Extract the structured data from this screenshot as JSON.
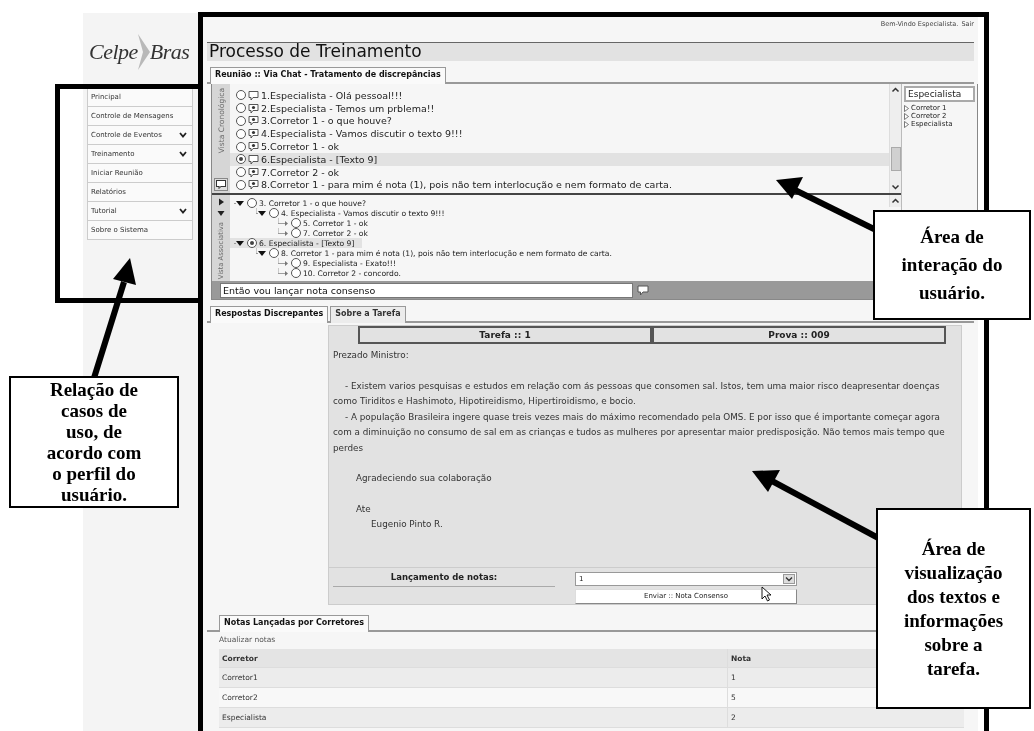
{
  "sidebar": {
    "logo": {
      "left": "Celpe",
      "right": "Bras"
    },
    "items": [
      {
        "label": "Principal",
        "kind": "link"
      },
      {
        "label": "Controle de Mensagens",
        "kind": "link"
      },
      {
        "label": "Controle de Eventos",
        "kind": "menu"
      },
      {
        "label": "Treinamento",
        "kind": "menu"
      },
      {
        "label": "Iniciar Reunião",
        "kind": "link"
      },
      {
        "label": "Relatórios",
        "kind": "link"
      },
      {
        "label": "Tutorial",
        "kind": "menu"
      },
      {
        "label": "Sobre o Sistema",
        "kind": "link"
      }
    ]
  },
  "header": {
    "welcome": "Bem-Vindo Especialista.",
    "logout": "Sair"
  },
  "title": "Processo de Treinamento",
  "chat": {
    "tab": "Reunião :: Via Chat - Tratamento de discrepâncias",
    "chrono_label": "Vista Cronológica",
    "messages": [
      {
        "text": "1.Especialista - Olá pessoal!!!",
        "marked": false,
        "selected": false
      },
      {
        "text": "2.Especialista - Temos um prblema!!",
        "marked": true,
        "selected": false
      },
      {
        "text": "3.Corretor 1 - o que houve?",
        "marked": true,
        "selected": false
      },
      {
        "text": "4.Especialista - Vamos discutir o texto 9!!!",
        "marked": true,
        "selected": false
      },
      {
        "text": "5.Corretor 1 - ok",
        "marked": true,
        "selected": false
      },
      {
        "text": "6.Especialista - [Texto 9]",
        "marked": false,
        "selected": true
      },
      {
        "text": "7.Corretor 2 - ok",
        "marked": true,
        "selected": false
      },
      {
        "text": "8.Corretor 1 - para mim é nota (1), pois não tem interlocução e nem formato de carta.",
        "marked": true,
        "selected": false
      }
    ],
    "assoc_label": "Vista Associativa",
    "tree": [
      {
        "text": "3. Corretor 1 - o que houve?",
        "expanded": true,
        "selected": false,
        "children": [
          {
            "text": "4. Especialista - Vamos discutir o texto 9!!!",
            "expanded": true,
            "selected": false,
            "children": [
              {
                "text": "5. Corretor 1 - ok",
                "expanded": false,
                "selected": false
              },
              {
                "text": "7. Corretor 2 - ok",
                "expanded": false,
                "selected": false
              }
            ]
          }
        ]
      },
      {
        "text": "6. Especialista - [Texto 9]",
        "expanded": true,
        "selected": true,
        "children": [
          {
            "text": "8. Corretor 1 - para mim é nota (1), pois não tem interlocução e nem formato de carta.",
            "expanded": true,
            "selected": false,
            "children": [
              {
                "text": "9. Especialista - Exato!!!",
                "expanded": false,
                "selected": false
              },
              {
                "text": "10. Corretor 2 - concordo.",
                "expanded": false,
                "selected": false
              }
            ]
          }
        ]
      }
    ],
    "input": {
      "value": "Então vou lançar nota consenso"
    },
    "users": {
      "header": "Especialista",
      "items": [
        "Corretor 1",
        "Corretor 2",
        "Especialista"
      ]
    }
  },
  "task": {
    "tabs": [
      {
        "label": "Respostas Discrepantes",
        "selected": true
      },
      {
        "label": "Sobre a Tarefa",
        "selected": false
      }
    ],
    "header": [
      "Tarefa :: 1",
      "Prova :: 009"
    ],
    "letter": [
      {
        "kind": "salutation",
        "text": "Prezado Ministro:"
      },
      {
        "kind": "paragraph",
        "text": "- Existem varios pesquisas e estudos em relação com ás pessoas que consomen sal. Istos, tem uma maior risco deapresentar doenças como Tiriditos e Hashimoto, Hipotireidismo, Hipertiroidismo, e bocio."
      },
      {
        "kind": "paragraph",
        "text": "- A população Brasileira ingere quase treis vezes mais do máximo recomendado pela OMS. E por isso que é importante começar agora com a diminuição no consumo de sal em as crianças e tudos as mulheres por apresentar maior predisposição. Não temos mais tempo que perdes"
      },
      {
        "kind": "closing",
        "text": "Agradeciendo sua colaboração"
      },
      {
        "kind": "closing",
        "text": "Ate"
      },
      {
        "kind": "signature",
        "text": "Eugenio Pinto R."
      }
    ],
    "grade_label": "Lançamento de notas:",
    "grade_select": {
      "value": "1"
    },
    "submit": "Enviar :: Nota Consenso"
  },
  "notes": {
    "tab": "Notas Lançadas por Corretores",
    "refresh": "Atualizar notas",
    "columns": [
      "Corretor",
      "Nota"
    ],
    "rows": [
      [
        "Corretor1",
        "1"
      ],
      [
        "Corretor2",
        "5"
      ],
      [
        "Especialista",
        "2"
      ]
    ]
  },
  "callouts": [
    {
      "text": "Área de\ninteração do\nusuário."
    },
    {
      "text": "Relação de\ncasos de\nuso, de\nacordo com\no perfil do\nusuário."
    },
    {
      "text": "Área de\nvisualização\ndos textos e\ninformações\nsobre a\ntarefa."
    }
  ]
}
